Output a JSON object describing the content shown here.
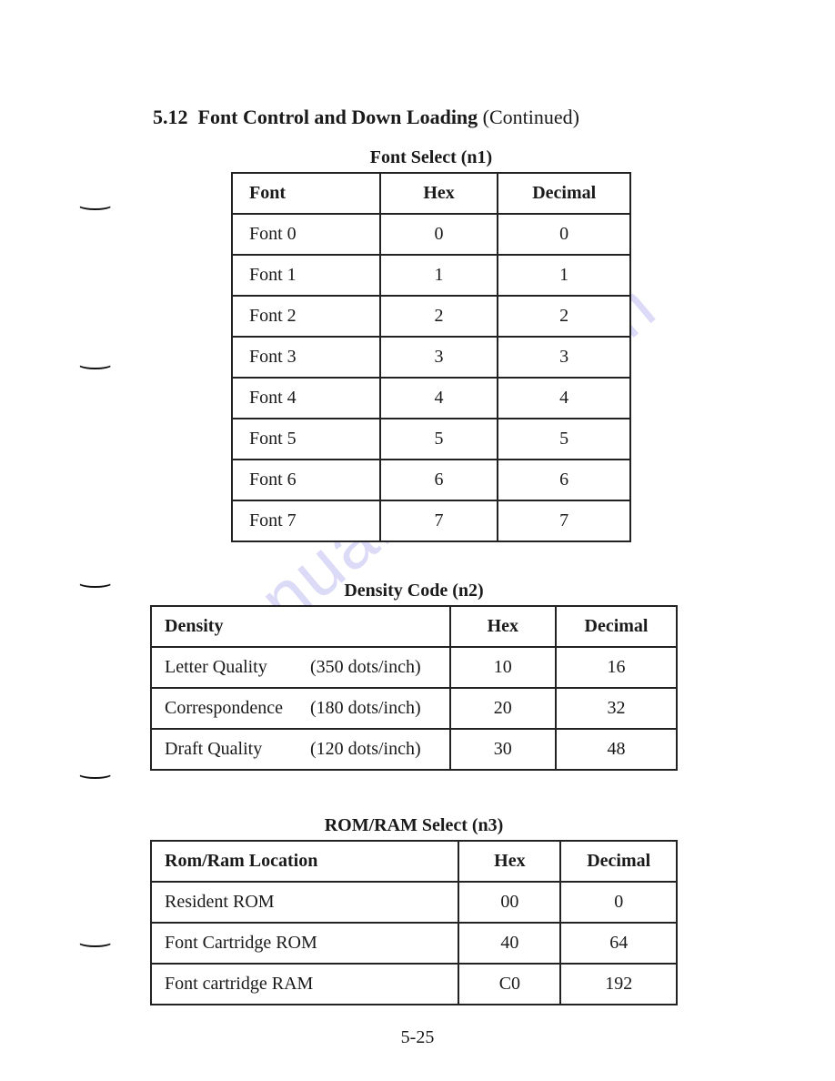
{
  "watermark": "manualshive.com",
  "heading": {
    "section": "5.12",
    "title": "Font Control and Down Loading",
    "continued": "(Continued)"
  },
  "table1": {
    "caption": "Font Select (n1)",
    "headers": {
      "c1": "Font",
      "c2": "Hex",
      "c3": "Decimal"
    },
    "rows": [
      {
        "font": "Font 0",
        "hex": "0",
        "dec": "0"
      },
      {
        "font": "Font 1",
        "hex": "1",
        "dec": "1"
      },
      {
        "font": "Font 2",
        "hex": "2",
        "dec": "2"
      },
      {
        "font": "Font 3",
        "hex": "3",
        "dec": "3"
      },
      {
        "font": "Font 4",
        "hex": "4",
        "dec": "4"
      },
      {
        "font": "Font 5",
        "hex": "5",
        "dec": "5"
      },
      {
        "font": "Font 6",
        "hex": "6",
        "dec": "6"
      },
      {
        "font": "Font 7",
        "hex": "7",
        "dec": "7"
      }
    ]
  },
  "table2": {
    "caption": "Density Code (n2)",
    "headers": {
      "c1": "Density",
      "c2": "Hex",
      "c3": "Decimal"
    },
    "rows": [
      {
        "name": "Letter Quality",
        "detail": "(350 dots/inch)",
        "hex": "10",
        "dec": "16"
      },
      {
        "name": "Correspondence",
        "detail": "(180 dots/inch)",
        "hex": "20",
        "dec": "32"
      },
      {
        "name": "Draft Quality",
        "detail": "(120 dots/inch)",
        "hex": "30",
        "dec": "48"
      }
    ]
  },
  "table3": {
    "caption": "ROM/RAM Select (n3)",
    "headers": {
      "c1": "Rom/Ram Location",
      "c2": "Hex",
      "c3": "Decimal"
    },
    "rows": [
      {
        "loc": "Resident ROM",
        "hex": "00",
        "dec": "0"
      },
      {
        "loc": "Font Cartridge ROM",
        "hex": "40",
        "dec": "64"
      },
      {
        "loc": "Font cartridge RAM",
        "hex": "C0",
        "dec": "192"
      }
    ]
  },
  "page_number": "5-25"
}
